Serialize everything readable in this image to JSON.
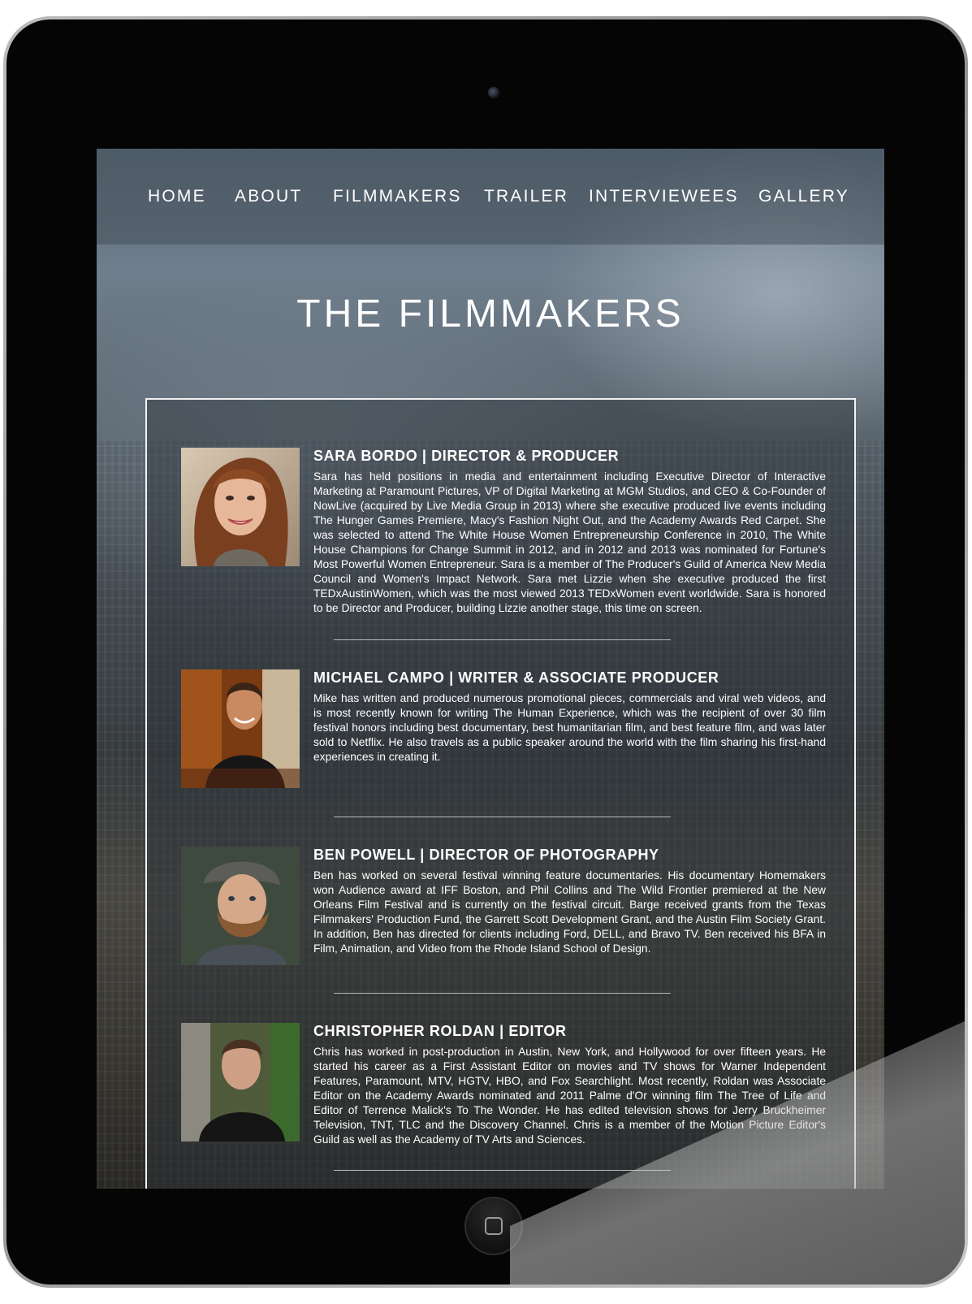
{
  "nav": {
    "items": [
      "HOME",
      "ABOUT",
      "FILMMAKERS",
      "TRAILER",
      "INTERVIEWEES",
      "GALLERY"
    ]
  },
  "page": {
    "title": "THE FILMMAKERS"
  },
  "filmmakers": [
    {
      "name": "SARA BORDO | DIRECTOR & PRODUCER",
      "bio": "Sara has held positions in media and entertainment including Executive Director of Interactive Marketing at Paramount Pictures, VP of Digital Marketing at MGM Studios, and CEO & Co-Founder of NowLive (acquired by Live Media Group in 2013) where she executive produced live events including The Hunger Games Premiere, Macy's Fashion Night Out, and the Academy Awards Red Carpet. She was selected to attend The White House Women Entrepreneurship Conference in 2010, The White House Champions for Change Summit in 2012, and in 2012 and 2013 was nominated for Fortune's Most Powerful Women Entrepreneur. Sara is a member of The Producer's Guild of America New Media Council and Women's Impact Network. Sara met Lizzie when she executive produced the first TEDxAustinWomen, which was the most viewed 2013 TEDxWomen event worldwide. Sara is honored to be Director and Producer, building Lizzie another stage, this time on screen."
    },
    {
      "name": "MICHAEL CAMPO | WRITER & ASSOCIATE PRODUCER",
      "bio": "Mike has written and produced numerous promotional pieces, commercials and viral web videos, and is most recently known for writing The Human Experience, which was the recipient of over 30 film festival honors including best documentary, best humanitarian film, and best feature film, and was later sold to Netflix. He also travels as a public speaker around the world with the film sharing his first-hand experiences in creating it."
    },
    {
      "name": "BEN POWELL | DIRECTOR OF PHOTOGRAPHY",
      "bio": "Ben has worked on several festival winning feature documentaries. His documentary Homemakers won Audience award at IFF Boston, and Phil Collins and The Wild Frontier premiered at the New Orleans Film Festival and is currently on the festival circuit. Barge received grants from the Texas Filmmakers' Production Fund, the Garrett Scott Development Grant, and the Austin Film Society Grant. In addition, Ben has directed for clients including Ford, DELL, and Bravo TV. Ben received his BFA in Film, Animation, and Video from the Rhode Island School of Design."
    },
    {
      "name": "CHRISTOPHER ROLDAN | EDITOR",
      "bio": "Chris has worked in post-production in Austin, New York, and Hollywood for over fifteen years. He started his career as a First Assistant Editor on movies and TV shows for Warner Independent Features, Paramount, MTV, HGTV, HBO, and Fox Searchlight. Most recently, Roldan was Associate Editor on the Academy Awards nominated and 2011 Palme d'Or winning film The Tree of Life and Editor of Terrence Malick's To The Wonder. He has edited television shows for Jerry Bruckheimer Television, TNT, TLC and the Discovery Channel. Chris is a member of the Motion Picture Editor's Guild as well as the Academy of TV Arts and Sciences."
    }
  ],
  "colors": {
    "device_bezel": "#050505",
    "text": "#ffffff",
    "panel_border": "#f2f2f2"
  }
}
